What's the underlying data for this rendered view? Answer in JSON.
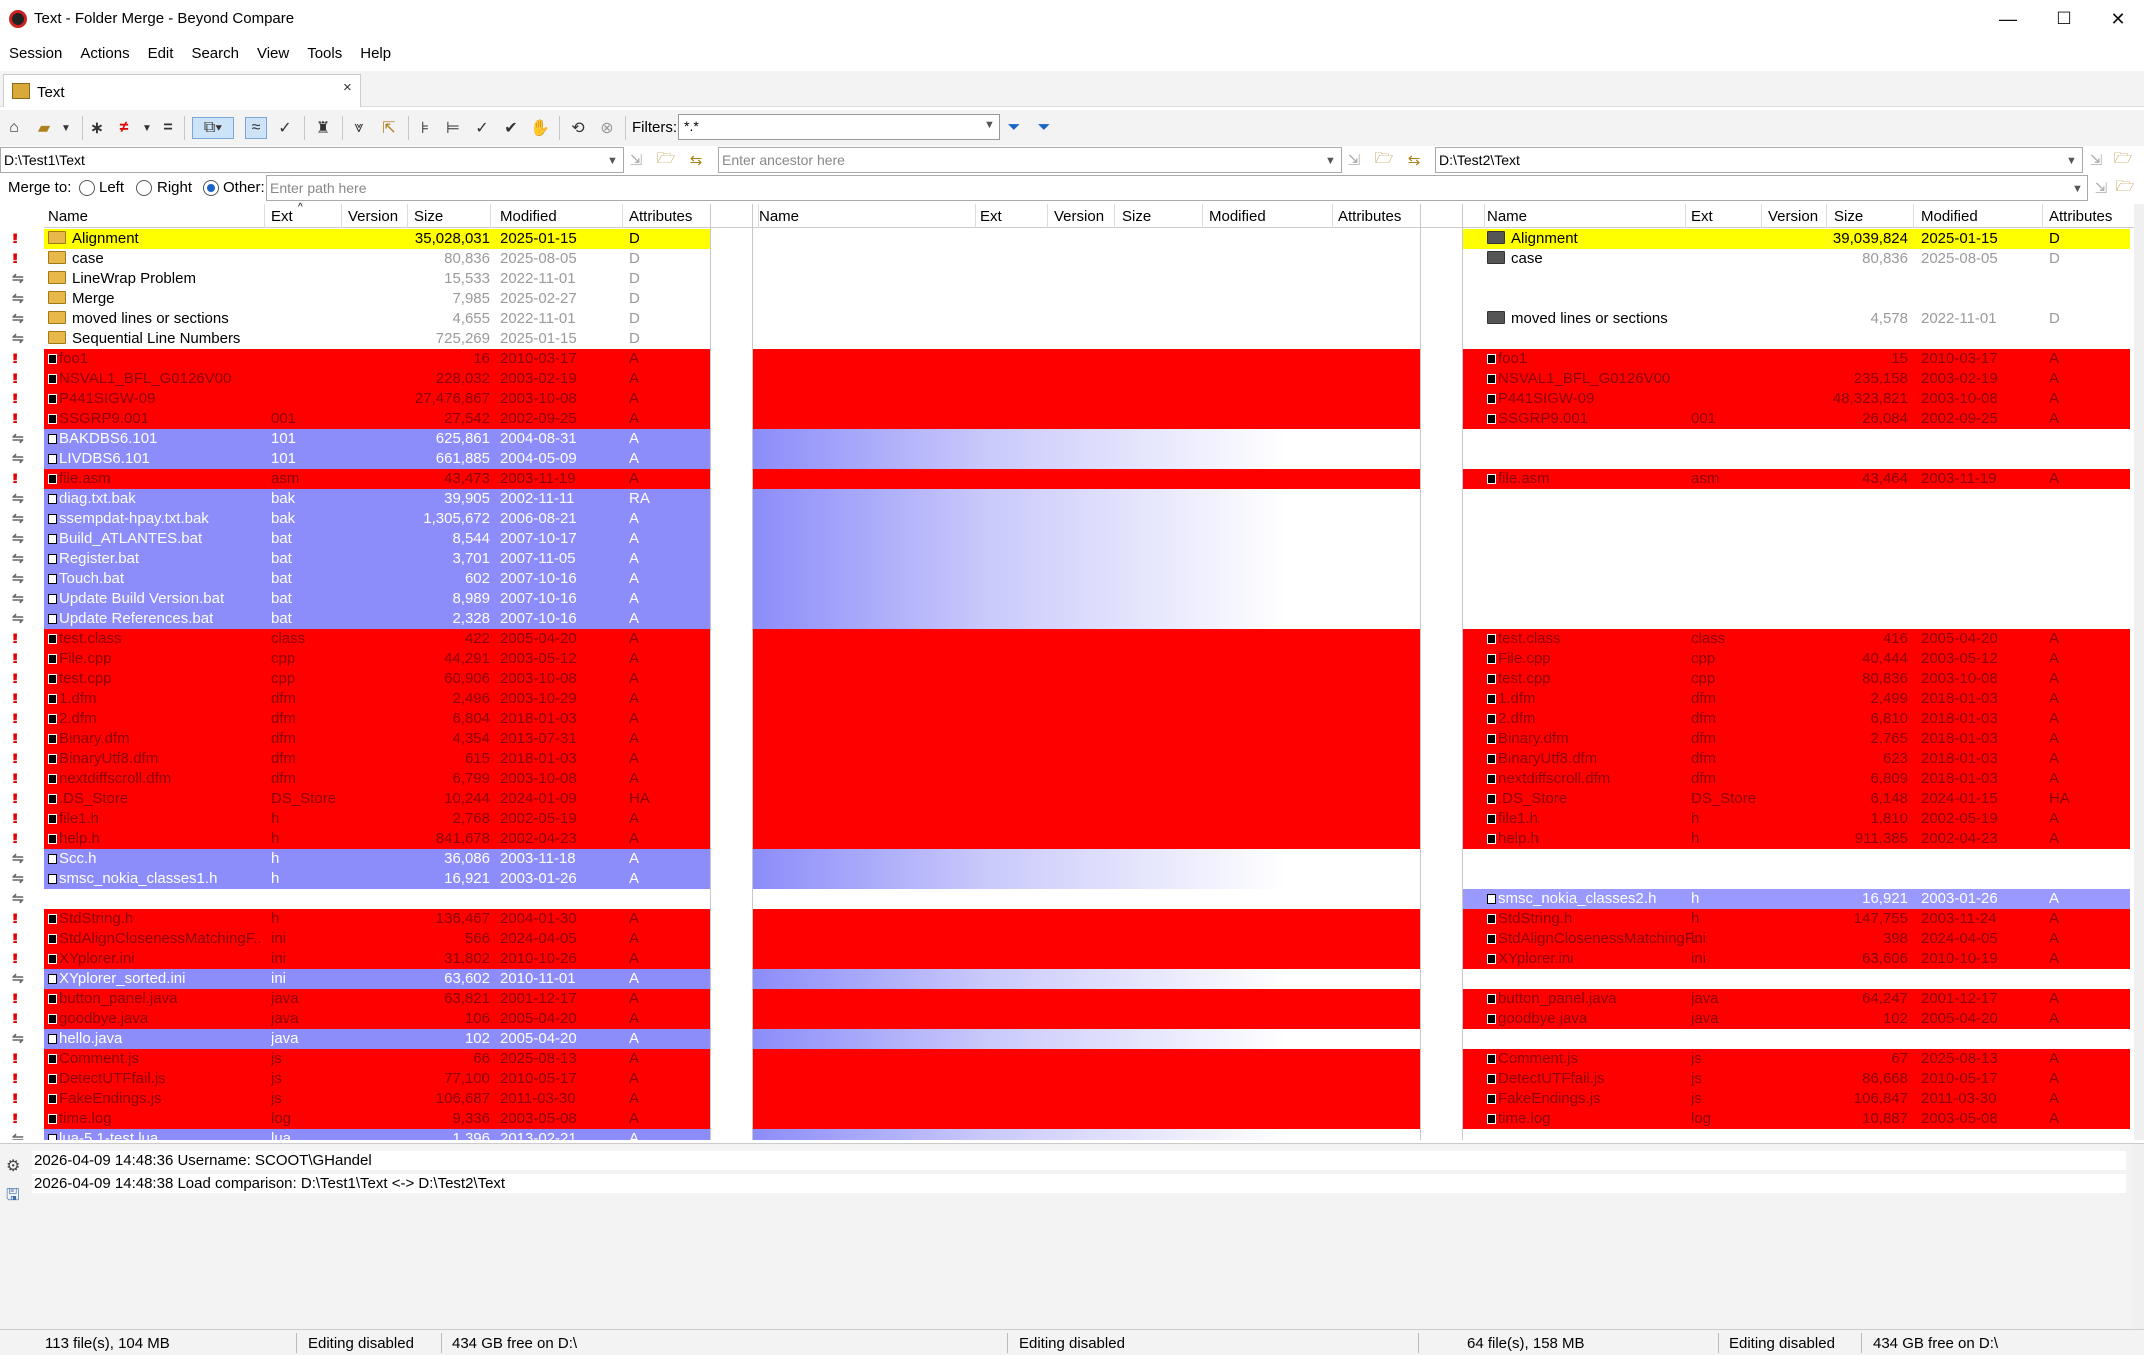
{
  "window": {
    "title": "Text - Folder Merge - Beyond Compare",
    "buttons": [
      "—",
      "☐",
      "✕"
    ]
  },
  "menu": [
    "Session",
    "Actions",
    "Edit",
    "Search",
    "View",
    "Tools",
    "Help"
  ],
  "tab": {
    "label": "Text",
    "close": "×"
  },
  "toolbar": {
    "filters_label": "Filters:",
    "filters_value": "*.*"
  },
  "paths": {
    "left": "D:\\Test1\\Text",
    "ancestor_placeholder": "Enter ancestor here",
    "right": "D:\\Test2\\Text"
  },
  "merge": {
    "label": "Merge to:",
    "left": "Left",
    "right": "Right",
    "other": "Other:",
    "other_placeholder": "Enter path here",
    "selected": "other"
  },
  "columns": {
    "left": [
      "Name",
      "Ext",
      "Version",
      "Size",
      "Modified",
      "Attributes"
    ],
    "center": [
      "Name",
      "Ext",
      "Version",
      "Size",
      "Modified",
      "Attributes"
    ],
    "right": [
      "Name",
      "Ext",
      "Version",
      "Size",
      "Modified",
      "Attributes"
    ]
  },
  "colors": {
    "conflict": "#ff0000",
    "left_only": "#8c8cfa",
    "selected": "#ffff00",
    "right_only": "#9999ff"
  },
  "rows": [
    {
      "s": "!!",
      "t": "sel",
      "l": [
        "Alignment",
        "",
        "",
        "35,028,031",
        "2025-01-15",
        "D"
      ],
      "r": [
        "Alignment",
        "",
        "",
        "39,039,824",
        "2025-01-15",
        "D"
      ],
      "folder": true
    },
    {
      "s": "!!",
      "t": "gray",
      "l": [
        "case",
        "",
        "",
        "80,836",
        "2025-08-05",
        "D"
      ],
      "r": [
        "case",
        "",
        "",
        "80,836",
        "2025-08-05",
        "D"
      ],
      "folder": true
    },
    {
      "s": "⇋",
      "t": "gray",
      "l": [
        "LineWrap Problem",
        "",
        "",
        "15,533",
        "2022-11-01",
        "D"
      ],
      "folder": true
    },
    {
      "s": "⇋",
      "t": "gray",
      "l": [
        "Merge",
        "",
        "",
        "7,985",
        "2025-02-27",
        "D"
      ],
      "folder": true
    },
    {
      "s": "⇋",
      "t": "gray",
      "l": [
        "moved lines or sections",
        "",
        "",
        "4,655",
        "2022-11-01",
        "D"
      ],
      "r": [
        "moved lines or sections",
        "",
        "",
        "4,578",
        "2022-11-01",
        "D"
      ],
      "folder": true
    },
    {
      "s": "⇋",
      "t": "gray",
      "l": [
        "Sequential Line Numbers",
        "",
        "",
        "725,269",
        "2025-01-15",
        "D"
      ],
      "folder": true
    },
    {
      "s": "!!",
      "t": "red",
      "l": [
        "foo1",
        "",
        "",
        "16",
        "2010-03-17",
        "A"
      ],
      "r": [
        "foo1",
        "",
        "",
        "15",
        "2010-03-17",
        "A"
      ]
    },
    {
      "s": "!!",
      "t": "red",
      "l": [
        "NSVAL1_BFL_G0126V00",
        "",
        "",
        "228,032",
        "2003-02-19",
        "A"
      ],
      "r": [
        "NSVAL1_BFL_G0126V00",
        "",
        "",
        "235,158",
        "2003-02-19",
        "A"
      ]
    },
    {
      "s": "!!",
      "t": "red",
      "l": [
        "P441SIGW-09",
        "",
        "",
        "27,476,867",
        "2003-10-08",
        "A"
      ],
      "r": [
        "P441SIGW-09",
        "",
        "",
        "48,323,821",
        "2003-10-08",
        "A"
      ]
    },
    {
      "s": "!!",
      "t": "red",
      "l": [
        "SSGRP9.001",
        "001",
        "",
        "27,542",
        "2002-09-25",
        "A"
      ],
      "r": [
        "SSGRP9.001",
        "001",
        "",
        "26,084",
        "2002-09-25",
        "A"
      ]
    },
    {
      "s": "⇋",
      "t": "blue",
      "l": [
        "BAKDBS6.101",
        "101",
        "",
        "625,861",
        "2004-08-31",
        "A"
      ]
    },
    {
      "s": "⇋",
      "t": "blue",
      "l": [
        "LIVDBS6.101",
        "101",
        "",
        "661,885",
        "2004-05-09",
        "A"
      ]
    },
    {
      "s": "!!",
      "t": "red",
      "l": [
        "file.asm",
        "asm",
        "",
        "43,473",
        "2003-11-19",
        "A"
      ],
      "r": [
        "file.asm",
        "asm",
        "",
        "43,464",
        "2003-11-19",
        "A"
      ]
    },
    {
      "s": "⇋",
      "t": "blue",
      "l": [
        "diag.txt.bak",
        "bak",
        "",
        "39,905",
        "2002-11-11",
        "RA"
      ]
    },
    {
      "s": "⇋",
      "t": "blue",
      "l": [
        "ssempdat-hpay.txt.bak",
        "bak",
        "",
        "1,305,672",
        "2006-08-21",
        "A"
      ]
    },
    {
      "s": "⇋",
      "t": "blue",
      "l": [
        "Build_ATLANTES.bat",
        "bat",
        "",
        "8,544",
        "2007-10-17",
        "A"
      ]
    },
    {
      "s": "⇋",
      "t": "blue",
      "l": [
        "Register.bat",
        "bat",
        "",
        "3,701",
        "2007-11-05",
        "A"
      ]
    },
    {
      "s": "⇋",
      "t": "blue",
      "l": [
        "Touch.bat",
        "bat",
        "",
        "602",
        "2007-10-16",
        "A"
      ]
    },
    {
      "s": "⇋",
      "t": "blue",
      "l": [
        "Update Build Version.bat",
        "bat",
        "",
        "8,989",
        "2007-10-16",
        "A"
      ]
    },
    {
      "s": "⇋",
      "t": "blue",
      "l": [
        "Update References.bat",
        "bat",
        "",
        "2,328",
        "2007-10-16",
        "A"
      ]
    },
    {
      "s": "!!",
      "t": "red",
      "l": [
        "test.class",
        "class",
        "",
        "422",
        "2005-04-20",
        "A"
      ],
      "r": [
        "test.class",
        "class",
        "",
        "416",
        "2005-04-20",
        "A"
      ]
    },
    {
      "s": "!!",
      "t": "red",
      "l": [
        "File.cpp",
        "cpp",
        "",
        "44,291",
        "2003-05-12",
        "A"
      ],
      "r": [
        "File.cpp",
        "cpp",
        "",
        "40,444",
        "2003-05-12",
        "A"
      ]
    },
    {
      "s": "!!",
      "t": "red",
      "l": [
        "test.cpp",
        "cpp",
        "",
        "60,906",
        "2003-10-08",
        "A"
      ],
      "r": [
        "test.cpp",
        "cpp",
        "",
        "80,836",
        "2003-10-08",
        "A"
      ]
    },
    {
      "s": "!!",
      "t": "red",
      "l": [
        "1.dfm",
        "dfm",
        "",
        "2,496",
        "2003-10-29",
        "A"
      ],
      "r": [
        "1.dfm",
        "dfm",
        "",
        "2,499",
        "2018-01-03",
        "A"
      ]
    },
    {
      "s": "!!",
      "t": "red",
      "l": [
        "2.dfm",
        "dfm",
        "",
        "6,804",
        "2018-01-03",
        "A"
      ],
      "r": [
        "2.dfm",
        "dfm",
        "",
        "6,810",
        "2018-01-03",
        "A"
      ]
    },
    {
      "s": "!!",
      "t": "red",
      "l": [
        "Binary.dfm",
        "dfm",
        "",
        "4,354",
        "2013-07-31",
        "A"
      ],
      "r": [
        "Binary.dfm",
        "dfm",
        "",
        "2,765",
        "2018-01-03",
        "A"
      ]
    },
    {
      "s": "!!",
      "t": "red",
      "l": [
        "BinaryUtf8.dfm",
        "dfm",
        "",
        "615",
        "2018-01-03",
        "A"
      ],
      "r": [
        "BinaryUtf8.dfm",
        "dfm",
        "",
        "623",
        "2018-01-03",
        "A"
      ]
    },
    {
      "s": "!!",
      "t": "red",
      "l": [
        "nextdiffscroll.dfm",
        "dfm",
        "",
        "6,799",
        "2003-10-08",
        "A"
      ],
      "r": [
        "nextdiffscroll.dfm",
        "dfm",
        "",
        "6,809",
        "2018-01-03",
        "A"
      ]
    },
    {
      "s": "!!",
      "t": "red",
      "l": [
        ".DS_Store",
        "DS_Store",
        "",
        "10,244",
        "2024-01-09",
        "HA"
      ],
      "r": [
        ".DS_Store",
        "DS_Store",
        "",
        "6,148",
        "2024-01-15",
        "HA"
      ]
    },
    {
      "s": "!!",
      "t": "red",
      "l": [
        "file1.h",
        "h",
        "",
        "2,768",
        "2002-05-19",
        "A"
      ],
      "r": [
        "file1.h",
        "h",
        "",
        "1,810",
        "2002-05-19",
        "A"
      ]
    },
    {
      "s": "!!",
      "t": "red",
      "l": [
        "help.h",
        "h",
        "",
        "841,678",
        "2002-04-23",
        "A"
      ],
      "r": [
        "help.h",
        "h",
        "",
        "911,385",
        "2002-04-23",
        "A"
      ]
    },
    {
      "s": "⇋",
      "t": "blue",
      "l": [
        "Scc.h",
        "h",
        "",
        "36,086",
        "2003-11-18",
        "A"
      ]
    },
    {
      "s": "⇋",
      "t": "blue",
      "l": [
        "smsc_nokia_classes1.h",
        "h",
        "",
        "16,921",
        "2003-01-26",
        "A"
      ]
    },
    {
      "s": "⇋",
      "t": "rblue",
      "r": [
        "smsc_nokia_classes2.h",
        "h",
        "",
        "16,921",
        "2003-01-26",
        "A"
      ]
    },
    {
      "s": "!!",
      "t": "red",
      "l": [
        "StdString.h",
        "h",
        "",
        "136,467",
        "2004-01-30",
        "A"
      ],
      "r": [
        "StdString.h",
        "h",
        "",
        "147,755",
        "2003-11-24",
        "A"
      ]
    },
    {
      "s": "!!",
      "t": "red",
      "l": [
        "StdAlignClosenessMatchingF...",
        "ini",
        "",
        "566",
        "2024-04-05",
        "A"
      ],
      "r": [
        "StdAlignClosenessMatchingF...",
        "ini",
        "",
        "398",
        "2024-04-05",
        "A"
      ]
    },
    {
      "s": "!!",
      "t": "red",
      "l": [
        "XYplorer.ini",
        "ini",
        "",
        "31,802",
        "2010-10-26",
        "A"
      ],
      "r": [
        "XYplorer.ini",
        "ini",
        "",
        "63,606",
        "2010-10-19",
        "A"
      ]
    },
    {
      "s": "⇋",
      "t": "blue",
      "l": [
        "XYplorer_sorted.ini",
        "ini",
        "",
        "63,602",
        "2010-11-01",
        "A"
      ]
    },
    {
      "s": "!!",
      "t": "red",
      "l": [
        "button_panel.java",
        "java",
        "",
        "63,821",
        "2001-12-17",
        "A"
      ],
      "r": [
        "button_panel.java",
        "java",
        "",
        "64,247",
        "2001-12-17",
        "A"
      ]
    },
    {
      "s": "!!",
      "t": "red",
      "l": [
        "goodbye.java",
        "java",
        "",
        "106",
        "2005-04-20",
        "A"
      ],
      "r": [
        "goodbye.java",
        "java",
        "",
        "102",
        "2005-04-20",
        "A"
      ]
    },
    {
      "s": "⇋",
      "t": "blue",
      "l": [
        "hello.java",
        "java",
        "",
        "102",
        "2005-04-20",
        "A"
      ]
    },
    {
      "s": "!!",
      "t": "red",
      "l": [
        "Comment.js",
        "js",
        "",
        "66",
        "2025-08-13",
        "A"
      ],
      "r": [
        "Comment.js",
        "js",
        "",
        "67",
        "2025-08-13",
        "A"
      ]
    },
    {
      "s": "!!",
      "t": "red",
      "l": [
        "DetectUTFfail.js",
        "js",
        "",
        "77,100",
        "2010-05-17",
        "A"
      ],
      "r": [
        "DetectUTFfail.js",
        "js",
        "",
        "86,668",
        "2010-05-17",
        "A"
      ]
    },
    {
      "s": "!!",
      "t": "red",
      "l": [
        "FakeEndings.js",
        "js",
        "",
        "106,687",
        "2011-03-30",
        "A"
      ],
      "r": [
        "FakeEndings.js",
        "js",
        "",
        "106,847",
        "2011-03-30",
        "A"
      ]
    },
    {
      "s": "!!",
      "t": "red",
      "l": [
        "time.log",
        "log",
        "",
        "9,336",
        "2003-05-08",
        "A"
      ],
      "r": [
        "time.log",
        "log",
        "",
        "10,887",
        "2003-05-08",
        "A"
      ]
    },
    {
      "s": "⇋",
      "t": "blue",
      "l": [
        "lua-5.1-test.lua",
        "lua",
        "",
        "1,396",
        "2013-02-21",
        "A"
      ]
    }
  ],
  "log": [
    "2026-04-09 14:48:36  Username: SCOOT\\GHandel",
    "2026-04-09 14:48:38  Load comparison: D:\\Test1\\Text <-> D:\\Test2\\Text"
  ],
  "status": {
    "left_files": "113 file(s), 104 MB",
    "left_edit": "Editing disabled",
    "left_free": "434 GB free on D:\\",
    "center_edit": "Editing disabled",
    "right_files": "64 file(s), 158 MB",
    "right_edit": "Editing disabled",
    "right_free": "434 GB free on D:\\"
  }
}
